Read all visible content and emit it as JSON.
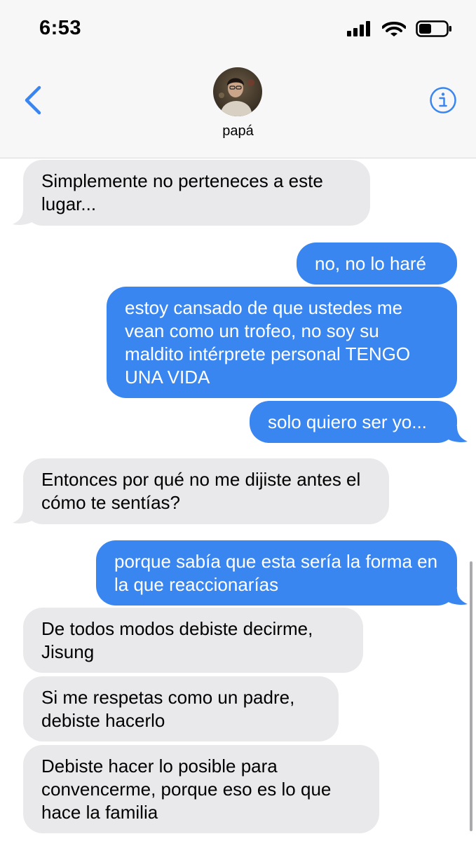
{
  "status_bar": {
    "time": "6:53",
    "icons": [
      "signal-icon",
      "wifi-icon",
      "battery-icon"
    ]
  },
  "header": {
    "back_icon": "chevron-left-icon",
    "contact_name": "papá",
    "info_icon": "info-icon"
  },
  "colors": {
    "sent_bubble": "#3a86f0",
    "received_bubble": "#e9e9eb",
    "accent": "#3a86f0"
  },
  "messages": [
    {
      "direction": "received",
      "text": "Simplemente no perteneces a este lugar..."
    },
    {
      "direction": "sent",
      "text": "no, no lo haré"
    },
    {
      "direction": "sent",
      "text": "estoy cansado de que ustedes me vean como un trofeo, no soy su maldito intérprete personal TENGO UNA VIDA"
    },
    {
      "direction": "sent",
      "text": "solo quiero ser yo..."
    },
    {
      "direction": "received",
      "text": "Entonces por qué no me dijiste antes el cómo te sentías?"
    },
    {
      "direction": "sent",
      "text": "porque sabía que esta sería la forma en la que reaccionarías"
    },
    {
      "direction": "received",
      "text": "De todos modos debiste decirme, Jisung"
    },
    {
      "direction": "received",
      "text": "Si me respetas como un padre, debiste hacerlo"
    },
    {
      "direction": "received",
      "text": "Debiste hacer lo posible para convencerme, porque eso es lo que hace la familia"
    }
  ]
}
